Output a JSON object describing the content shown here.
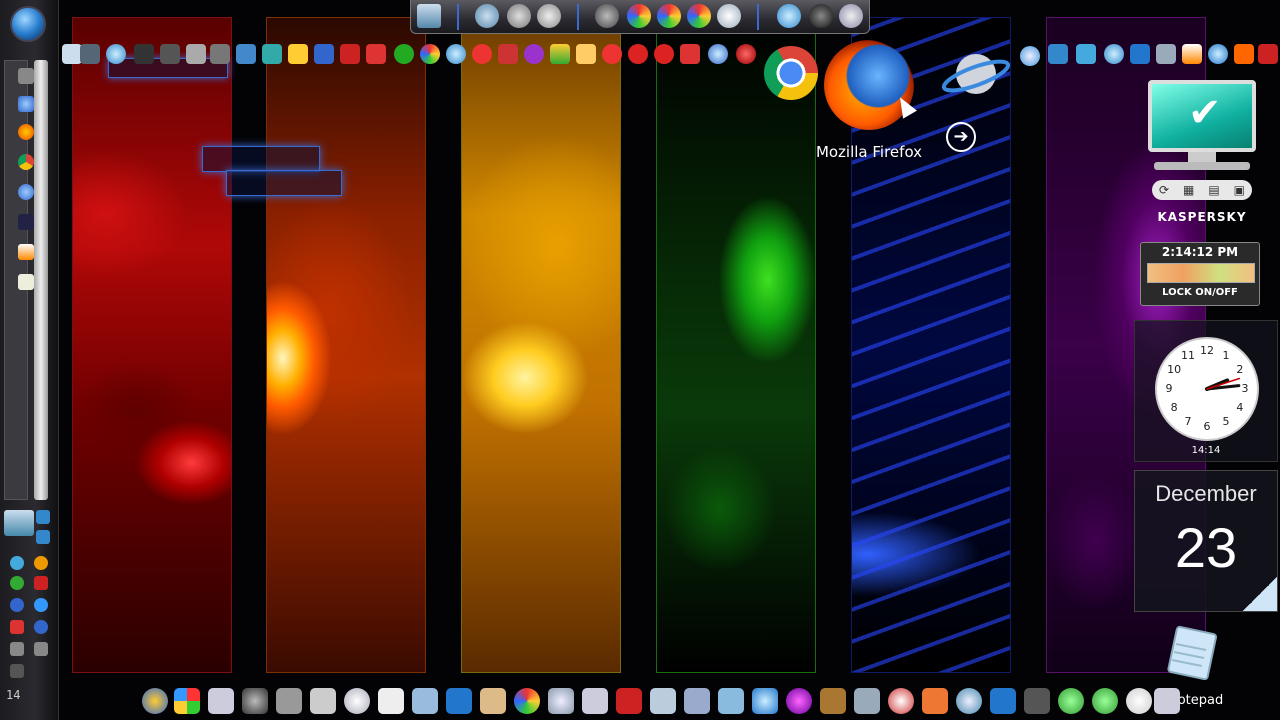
{
  "wallpaper": {
    "panels": [
      {
        "name": "red",
        "color": "#c01010"
      },
      {
        "name": "orange",
        "color": "#e05000"
      },
      {
        "name": "yellow",
        "color": "#f0b000"
      },
      {
        "name": "green",
        "color": "#20a020"
      },
      {
        "name": "blue",
        "color": "#2040ff"
      },
      {
        "name": "purple",
        "color": "#a020c0"
      }
    ]
  },
  "dock": {
    "hovered_item_label": "Mozilla Firefox",
    "next_arrow": "➔"
  },
  "kaspersky": {
    "logo_text": "KASPERSKY",
    "check": "✔",
    "buttons": [
      "⟳",
      "▦",
      "▤",
      "▣"
    ]
  },
  "lock_clock": {
    "time": "2:14:12 PM",
    "label": "LOCK ON/OFF"
  },
  "analog_clock": {
    "digital": "14:14",
    "numbers": [
      "12",
      "1",
      "2",
      "3",
      "4",
      "5",
      "6",
      "7",
      "8",
      "9",
      "10",
      "11"
    ],
    "hour": 2,
    "minute": 14,
    "second": 12
  },
  "calendar": {
    "month": "December",
    "day": "23"
  },
  "notepad": {
    "label": "Notepad"
  },
  "left_tray": {
    "clock_text": "14"
  }
}
